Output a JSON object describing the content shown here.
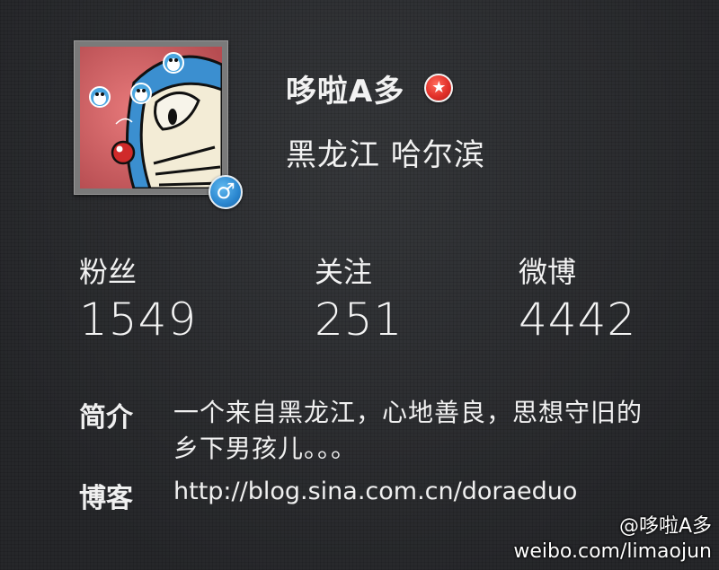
{
  "profile": {
    "name": "哆啦A多",
    "verified_badge_icon": "star-icon",
    "gender_icon": "male-icon",
    "location": "黑龙江 哈尔滨"
  },
  "stats": {
    "fans": {
      "label": "粉丝",
      "value": "1549"
    },
    "following": {
      "label": "关注",
      "value": "251"
    },
    "posts": {
      "label": "微博",
      "value": "4442"
    }
  },
  "bio": {
    "label": "简介",
    "text": "一个来自黑龙江，心地善良，思想守旧的乡下男孩儿。。。"
  },
  "blog": {
    "label": "博客",
    "url": "http://blog.sina.com.cn/doraeduo"
  },
  "watermark": {
    "line1": "@哆啦A多",
    "line2": "weibo.com/limaojun"
  },
  "colors": {
    "background": "#2b2c2e",
    "verify_badge": "#e2312a",
    "gender_badge": "#2a86cf",
    "avatar_bg": "#e06a6c"
  }
}
